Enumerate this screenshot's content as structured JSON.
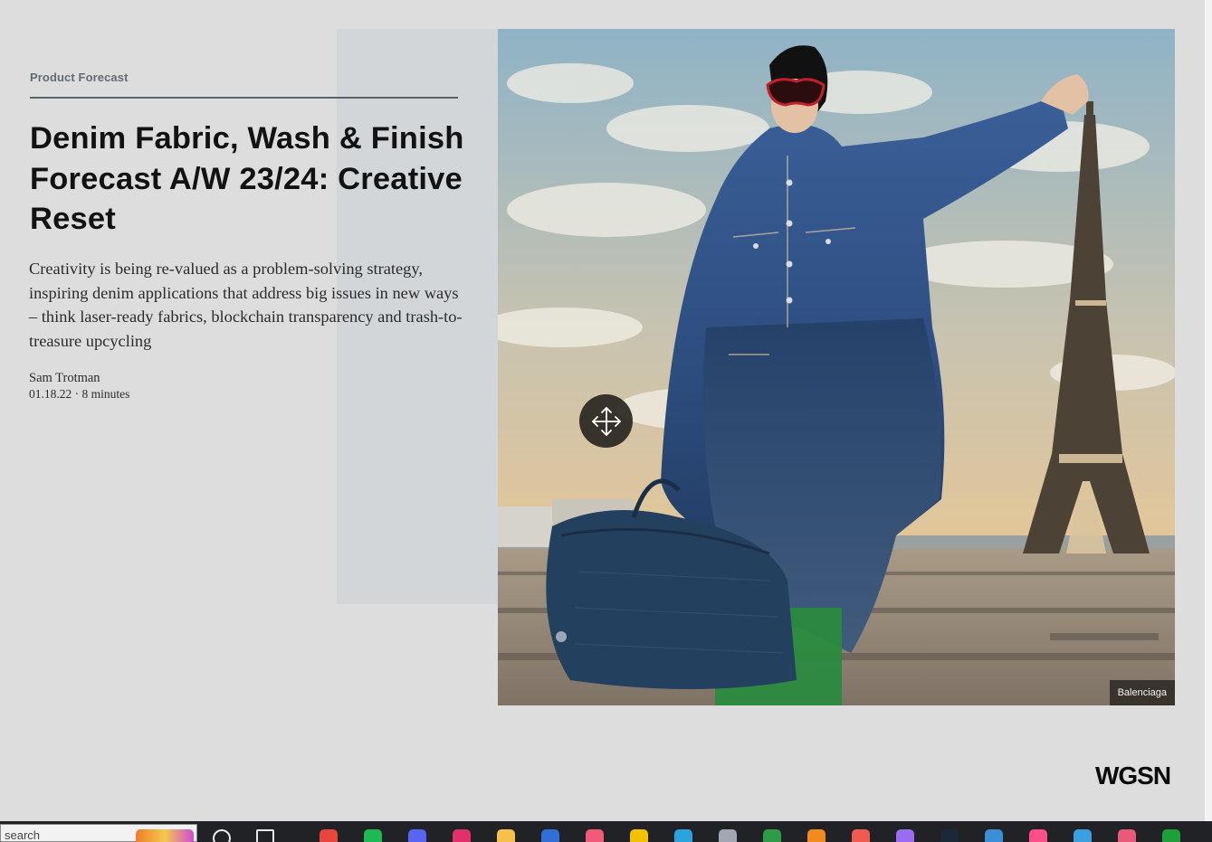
{
  "article": {
    "category": "Product Forecast",
    "title": "Denim Fabric, Wash & Finish Forecast A/W 23/24: Creative Reset",
    "summary": "Creativity is being re-valued as a problem-solving strategy, inspiring denim applications that address big issues in new ways – think laser-ready fabrics, blockchain transparency and trash-to-treasure upcycling",
    "author": "Sam Trotman",
    "date_and_reading_time": "01.18.22 · 8 minutes"
  },
  "hero_image": {
    "credit": "Balenciaga",
    "move_control_icon": "move-arrows-icon"
  },
  "brand": {
    "logo_text": "WGSN"
  },
  "taskbar": {
    "search_placeholder": "search",
    "apps": [
      {
        "name": "search-icon",
        "color": "#e9e9e9"
      },
      {
        "name": "task-view-icon",
        "color": "#e9e9e9"
      },
      {
        "name": "chrome-icon",
        "color": "#e8453c"
      },
      {
        "name": "spotify-icon",
        "color": "#1db954"
      },
      {
        "name": "discord-icon",
        "color": "#5865f2"
      },
      {
        "name": "instagram-icon",
        "color": "#e1306c"
      },
      {
        "name": "file-explorer-icon",
        "color": "#f6c14a"
      },
      {
        "name": "mail-icon",
        "color": "#2f6fd6"
      },
      {
        "name": "itunes-icon",
        "color": "#f25a7a"
      },
      {
        "name": "ladder-app-icon",
        "color": "#f2c200"
      },
      {
        "name": "telegram-icon",
        "color": "#2aa3df"
      },
      {
        "name": "calculator-icon",
        "color": "#a0a7b3"
      },
      {
        "name": "leaf-app-icon",
        "color": "#2e9b47"
      },
      {
        "name": "blender-icon",
        "color": "#f18a1f"
      },
      {
        "name": "colorful-app-icon",
        "color": "#f05a4f"
      },
      {
        "name": "purple-app-icon",
        "color": "#9b6cf0"
      },
      {
        "name": "steam-icon",
        "color": "#1b2838"
      },
      {
        "name": "water-drop-app-icon",
        "color": "#3a8fd8"
      },
      {
        "name": "play-store-icon",
        "color": "#ff4f8b"
      },
      {
        "name": "network-app-icon",
        "color": "#3aa0e0"
      },
      {
        "name": "camera-app-icon",
        "color": "#e85a78"
      },
      {
        "name": "xbox-icon",
        "color": "#1f9f3a"
      }
    ]
  }
}
